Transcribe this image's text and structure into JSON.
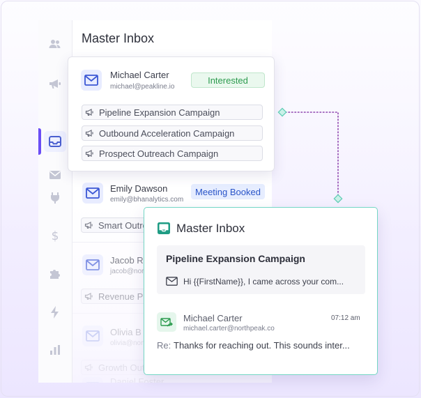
{
  "inbox": {
    "title": "Master Inbox",
    "rows": [
      {
        "name": "Emily Dawson",
        "email": "emily@bhanalytics.com",
        "badge": "Meeting Booked",
        "campaign": "Smart Outreach"
      },
      {
        "name": "Jacob Re",
        "email": "jacob@nort",
        "campaign": "Revenue Pip"
      },
      {
        "name": "Olivia B",
        "email": "olivia@nort",
        "campaign": "Growth Out"
      },
      {
        "name": "Daniel Foster"
      }
    ]
  },
  "popup_contact": {
    "name": "Michael Carter",
    "email": "michael@peakline.io",
    "badge": "Interested",
    "campaigns": [
      "Pipeline Expansion Campaign",
      "Outbound Acceleration Campaign",
      "Prospect Outreach Campaign"
    ]
  },
  "detail": {
    "title": "Master Inbox",
    "campaign_title": "Pipeline Expansion Campaign",
    "campaign_preview": "Hi {{FirstName}}, I came across your com...",
    "reply": {
      "name": "Michael Carter",
      "email": "michael.carter@northpeak.co",
      "time": "07:12 am",
      "prefix": "Re:",
      "text": "Thanks for reaching out. This sounds inter..."
    }
  },
  "colors": {
    "accent": "#6a4df5",
    "interested": "#2c9b4e",
    "meeting": "#2a55c8",
    "detail_border": "#73d6c4",
    "connector": "#8e44ad"
  },
  "icons": {
    "sidebar": [
      "users-icon",
      "megaphone-icon",
      "inbox-icon",
      "mail-icon",
      "plug-icon",
      "dollar-icon",
      "puzzle-icon",
      "bolt-icon",
      "chart-icon"
    ]
  }
}
